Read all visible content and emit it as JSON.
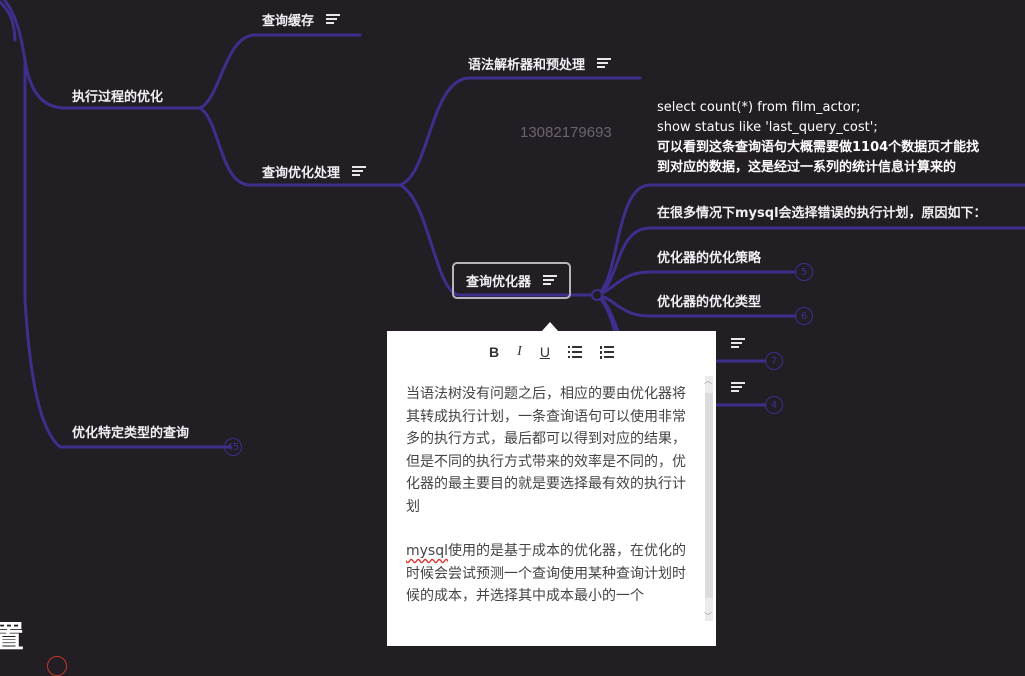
{
  "nodes": {
    "query_cache": "查询缓存",
    "exec_opt": "执行过程的优化",
    "query_opt_process": "查询优化处理",
    "parser": "语法解析器和预处理",
    "optimizer": "查询优化器",
    "specific_type": "优化特定类型的查询",
    "wrong_plan": "在很多情况下mysql会选择错误的执行计划，原因如下：",
    "strategy": "优化器的优化策略",
    "opt_type": "优化器的优化类型"
  },
  "sql_note": {
    "line1": "select count(*) from film_actor;",
    "line2": "show status like 'last_query_cost';",
    "line3": "可以看到这条查询语句大概需要做1104个数据页才能找",
    "line4": "到对应的数据，这是经过一系列的统计信息计算来的"
  },
  "badges": {
    "strategy": "5",
    "opt_type": "6",
    "child3": "7",
    "child4": "4",
    "specific_type": "45"
  },
  "watermark": "13082179693",
  "popover": {
    "toolbar": {
      "bold": "B",
      "italic": "I",
      "underline": "U"
    },
    "para1": "当语法树没有问题之后，相应的要由优化器将其转成执行计划，一条查询语句可以使用非常多的执行方式，最后都可以得到对应的结果，但是不同的执行方式带来的效率是不同的，优化器的最主要目的就是要选择最有效的执行计划",
    "para2_prefix": "mysql",
    "para2_rest": "使用的是基于成本的优化器，在优化的时候会尝试预测一个查询使用某种查询计划时候的成本，并选择其中成本最小的一个"
  },
  "bottom_char": "置",
  "colors": {
    "background": "#231d24",
    "branch": "#3f2f8c",
    "popover": "#ffffff"
  }
}
